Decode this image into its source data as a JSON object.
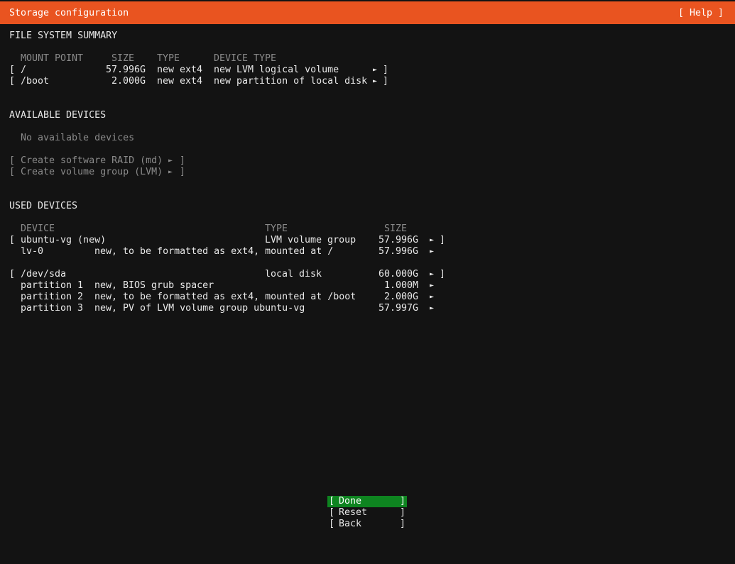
{
  "header": {
    "title": "Storage configuration",
    "help_label": "[ Help ]"
  },
  "fs_summary": {
    "heading": "FILE SYSTEM SUMMARY",
    "columns": [
      "MOUNT POINT",
      "SIZE",
      "TYPE",
      "DEVICE TYPE"
    ],
    "rows": [
      {
        "mount": "/",
        "size": "57.996G",
        "type": "new ext4",
        "device_type": "new LVM logical volume"
      },
      {
        "mount": "/boot",
        "size": "2.000G",
        "type": "new ext4",
        "device_type": "new partition of local disk"
      }
    ]
  },
  "available": {
    "heading": "AVAILABLE DEVICES",
    "empty_text": "No available devices",
    "actions": [
      "Create software RAID (md)",
      "Create volume group (LVM)"
    ]
  },
  "used": {
    "heading": "USED DEVICES",
    "columns": [
      "DEVICE",
      "TYPE",
      "SIZE"
    ],
    "groups": [
      {
        "name": "ubuntu-vg (new)",
        "type": "LVM volume group",
        "size": "57.996G",
        "children": [
          {
            "name": "lv-0",
            "desc": "new, to be formatted as ext4, mounted at /",
            "size": "57.996G"
          }
        ]
      },
      {
        "name": "/dev/sda",
        "type": "local disk",
        "size": "60.000G",
        "children": [
          {
            "name": "partition 1",
            "desc": "new, BIOS grub spacer",
            "size": "1.000M"
          },
          {
            "name": "partition 2",
            "desc": "new, to be formatted as ext4, mounted at /boot",
            "size": "2.000G"
          },
          {
            "name": "partition 3",
            "desc": "new, PV of LVM volume group ubuntu-vg",
            "size": "57.997G"
          }
        ]
      }
    ]
  },
  "buttons": {
    "done": "Done",
    "reset": "Reset",
    "back": "Back"
  },
  "glyphs": {
    "bracket_open": "[",
    "bracket_close": "]",
    "arrow": "►"
  },
  "colors": {
    "titlebar": "#e95420",
    "background": "#131313",
    "selected_button": "#0e8420",
    "dim_text": "#8a8a8a"
  }
}
